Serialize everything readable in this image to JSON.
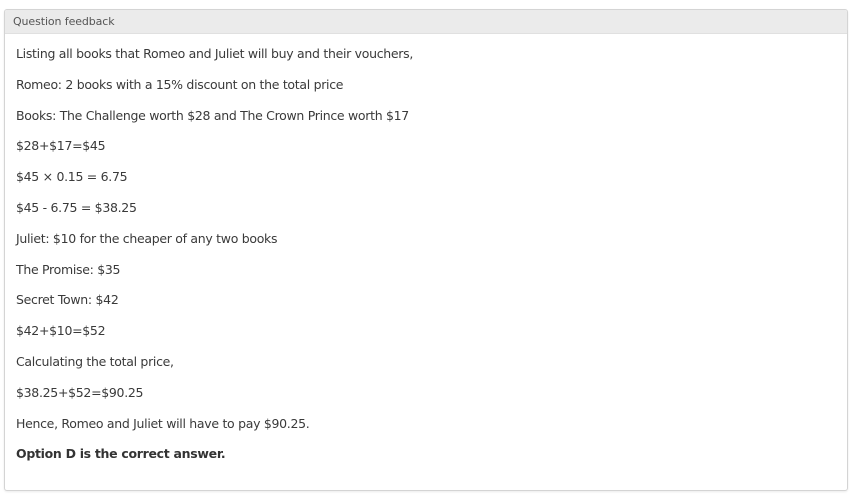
{
  "panel": {
    "title": "Question feedback"
  },
  "feedback": {
    "lines": [
      "Listing all books that Romeo and Juliet will buy and their vouchers,",
      "Romeo: 2 books with a 15% discount on the total price",
      "Books: The Challenge worth $28 and The Crown Prince worth $17",
      "$28+$17=$45",
      "$45 × 0.15 = 6.75",
      "$45 - 6.75 = $38.25",
      "Juliet: $10 for the cheaper of any two books",
      "The Promise: $35",
      "Secret Town: $42",
      "$42+$10=$52",
      "Calculating the total price,",
      "$38.25+$52=$90.25",
      "Hence, Romeo and Juliet will have to pay $90.25."
    ],
    "answer": "Option D is the correct answer."
  }
}
